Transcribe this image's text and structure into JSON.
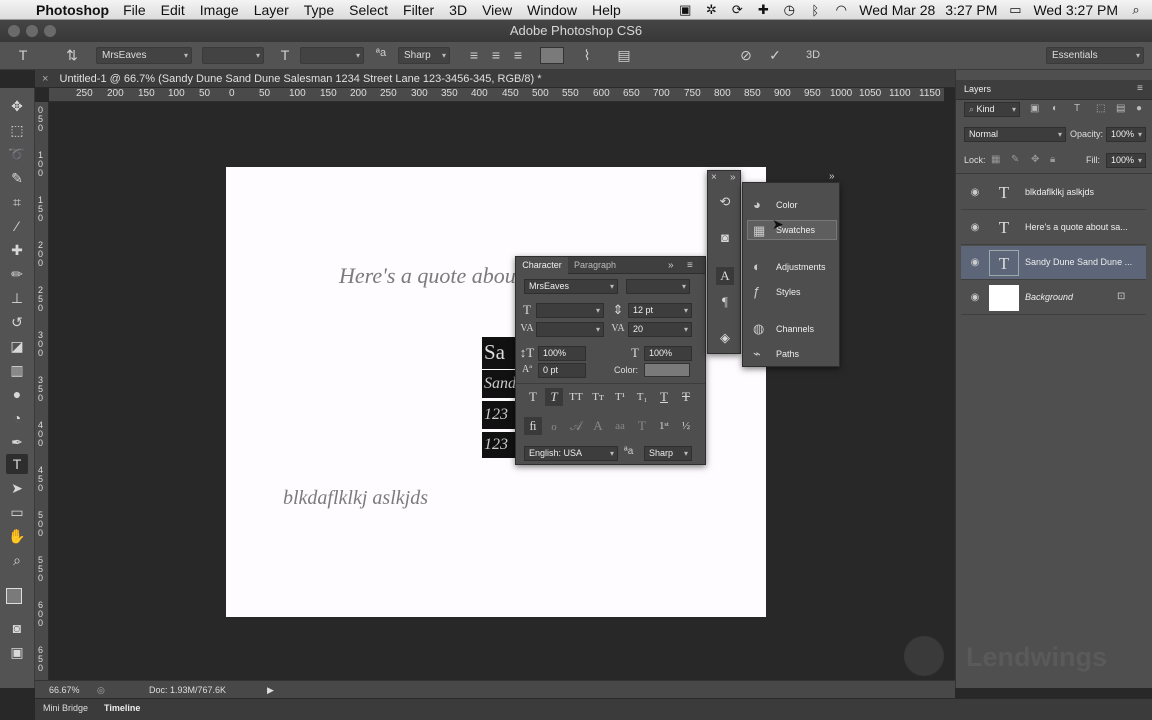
{
  "menubar": {
    "app": "Photoshop",
    "items": [
      "File",
      "Edit",
      "Image",
      "Layer",
      "Type",
      "Select",
      "Filter",
      "3D",
      "View",
      "Window",
      "Help"
    ],
    "date": "Wed Mar 28",
    "time": "3:27 PM",
    "clock": "Wed 3:27 PM"
  },
  "window_title": "Adobe Photoshop CS6",
  "options_bar": {
    "font_family": "MrsEaves",
    "antialias": "Sharp",
    "workspace": "Essentials",
    "threed": "3D"
  },
  "doc_tab": "Untitled-1 @ 66.7% (Sandy Dune Sand Dune Salesman 1234 Street Lane 123-3456-345, RGB/8) *",
  "ruler_h": [
    "250",
    "200",
    "150",
    "100",
    "50",
    "0",
    "50",
    "100",
    "150",
    "200",
    "250",
    "300",
    "350",
    "400",
    "450",
    "500",
    "550",
    "600",
    "650",
    "700",
    "750",
    "800",
    "850",
    "900",
    "950",
    "1000",
    "1050",
    "1100",
    "1150"
  ],
  "ruler_v": [
    "0",
    "5",
    "0",
    "1",
    "0",
    "0",
    "1",
    "5",
    "0",
    "2",
    "0",
    "0",
    "2",
    "5",
    "0",
    "3",
    "0",
    "0",
    "3",
    "5",
    "0",
    "4",
    "0",
    "0",
    "4",
    "5",
    "0",
    "5",
    "0",
    "0",
    "5",
    "5",
    "0",
    "6",
    "0",
    "0",
    "6",
    "5",
    "0",
    "7",
    "0",
    "0"
  ],
  "canvas": {
    "quote": "Here's a quote abou",
    "hl1": "Sa",
    "hl2": "Sand",
    "hl3": "123",
    "hl4": "123",
    "bottom": "blkdaflklkj aslkjds"
  },
  "character_panel": {
    "tab_character": "Character",
    "tab_paragraph": "Paragraph",
    "font_family": "MrsEaves",
    "leading": "12 pt",
    "tracking": "20",
    "vertical_scale": "100%",
    "horizontal_scale": "100%",
    "baseline": "0 pt",
    "color_label": "Color:",
    "language": "English: USA",
    "antialias": "Sharp"
  },
  "panel_dock": {
    "items": [
      "Color",
      "Swatches",
      "Adjustments",
      "Styles",
      "Channels",
      "Paths"
    ]
  },
  "layers_panel": {
    "title": "Layers",
    "kind": "Kind",
    "blend_mode": "Normal",
    "opacity_label": "Opacity:",
    "opacity": "100%",
    "lock_label": "Lock:",
    "fill_label": "Fill:",
    "fill": "100%",
    "layers": [
      {
        "name": "blkdaflklkj aslkjds",
        "kind": "T"
      },
      {
        "name": "Here's a quote about sa...",
        "kind": "T"
      },
      {
        "name": "Sandy Dune Sand Dune ...",
        "kind": "T"
      },
      {
        "name": "Background",
        "kind": ""
      }
    ]
  },
  "status_bar": {
    "zoom": "66.67%",
    "doc": "Doc: 1.93M/767.6K"
  },
  "bottom_tabs": [
    "Mini Bridge",
    "Timeline"
  ],
  "watermark": "Lendwings"
}
